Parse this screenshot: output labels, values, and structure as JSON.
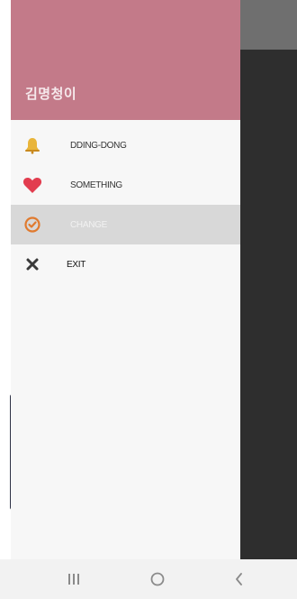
{
  "drawer": {
    "title": "김명청이",
    "header_color": "#c37a89",
    "items": [
      {
        "label": "DDING-DONG",
        "icon": "bell-icon",
        "color": "#e0a527",
        "selected": false
      },
      {
        "label": "SOMETHING",
        "icon": "heart-icon",
        "color": "#e23d4f",
        "selected": false
      },
      {
        "label": "CHANGE",
        "icon": "check-clock-icon",
        "color": "#e07a2e",
        "selected": true
      },
      {
        "label": "EXIT",
        "icon": "close-icon",
        "color": "#333333",
        "selected": false
      }
    ]
  },
  "navbar": {
    "buttons": [
      {
        "icon": "recent-apps-icon"
      },
      {
        "icon": "home-icon"
      },
      {
        "icon": "back-icon"
      }
    ]
  }
}
